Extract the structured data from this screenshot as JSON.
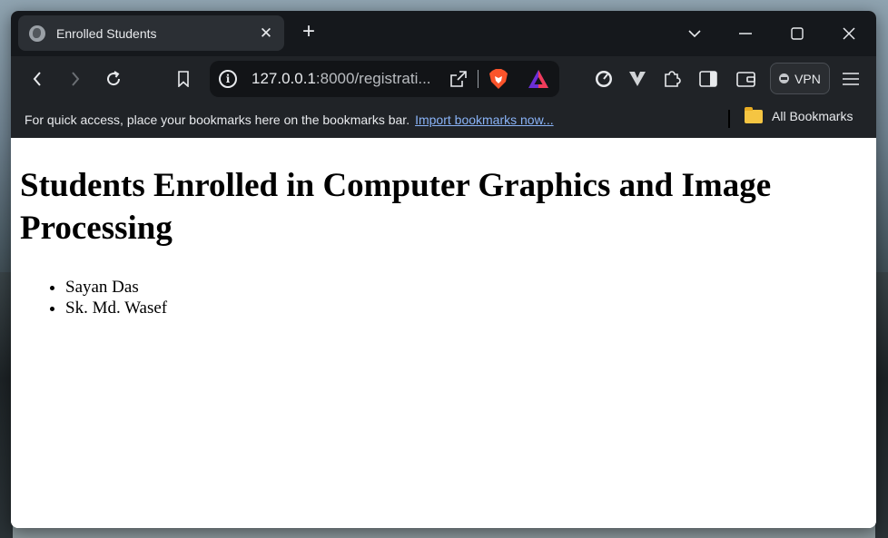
{
  "browser": {
    "tab_title": "Enrolled Students",
    "tab_close_icon": "close-icon",
    "new_tab_icon": "plus-icon",
    "url_host": "127.0.0.1",
    "url_rest": ":8000/registrati...",
    "vpn_label": "VPN",
    "accent_link_color": "#8ab4f8"
  },
  "bookmarks_bar": {
    "hint_text": "For quick access, place your bookmarks here on the bookmarks bar.",
    "import_link": "Import bookmarks now...",
    "all_bookmarks_label": "All Bookmarks"
  },
  "page": {
    "heading": "Students Enrolled in Computer Graphics and Image Processing",
    "students": [
      "Sayan Das",
      "Sk. Md. Wasef"
    ]
  }
}
